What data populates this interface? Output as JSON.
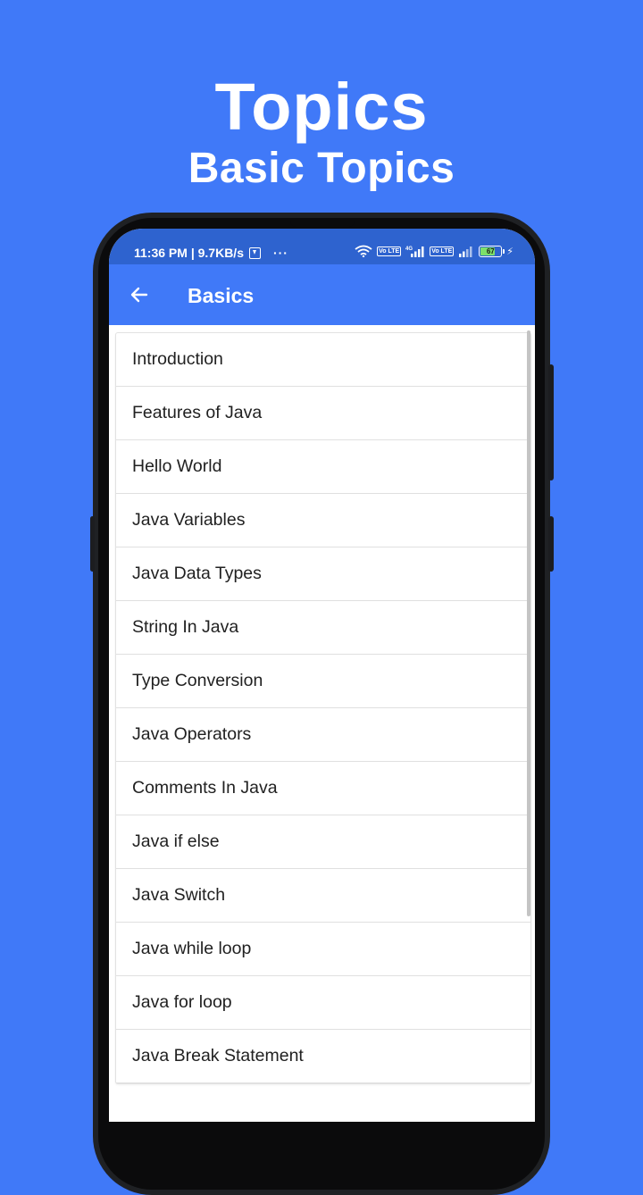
{
  "hero": {
    "title": "Topics",
    "subtitle": "Basic Topics"
  },
  "status_bar": {
    "time_speed": "11:36 PM | 9.7KB/s",
    "dots": "···",
    "battery": "67",
    "network_label": "4G",
    "volte_label": "Vo LTE"
  },
  "app_bar": {
    "title": "Basics"
  },
  "topics": {
    "items": [
      "Introduction",
      "Features of Java",
      "Hello World",
      "Java Variables",
      "Java Data Types",
      "String In Java",
      "Type Conversion",
      "Java Operators",
      "Comments In Java",
      "Java if else",
      "Java Switch",
      "Java while loop",
      "Java for loop",
      "Java Break Statement"
    ]
  },
  "colors": {
    "background": "#4079F8",
    "status_bar": "#2E63CF",
    "app_bar": "#4079F8",
    "battery": "#7DE06A"
  },
  "icons": {
    "back": "back-arrow-icon",
    "wifi": "wifi-icon",
    "signal": "signal-icon",
    "download": "download-icon",
    "charging": "charging-bolt-icon"
  }
}
